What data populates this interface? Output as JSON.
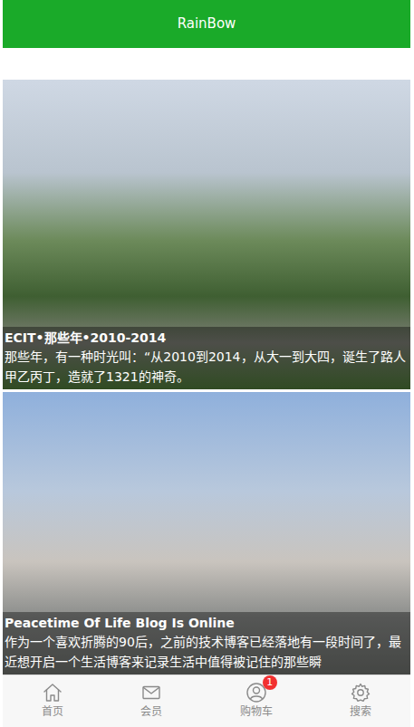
{
  "header": {
    "title": "RainBow"
  },
  "posts": [
    {
      "title": "ECIT•那些年•2010-2014",
      "excerpt": "那些年，有一种时光叫：“从2010到2014，从大一到大四，诞生了路人甲乙丙丁，造就了1321的神奇。"
    },
    {
      "title": "Peacetime Of Life Blog Is Online",
      "excerpt": "作为一个喜欢折腾的90后，之前的技术博客已经落地有一段时间了，最近想开启一个生活博客来记录生活中值得被记住的那些瞬"
    }
  ],
  "tabbar": [
    {
      "label": "首页",
      "selected": false
    },
    {
      "label": "会员",
      "selected": false
    },
    {
      "label": "购物车",
      "selected": false,
      "badge": "1"
    },
    {
      "label": "搜索",
      "selected": false
    }
  ]
}
